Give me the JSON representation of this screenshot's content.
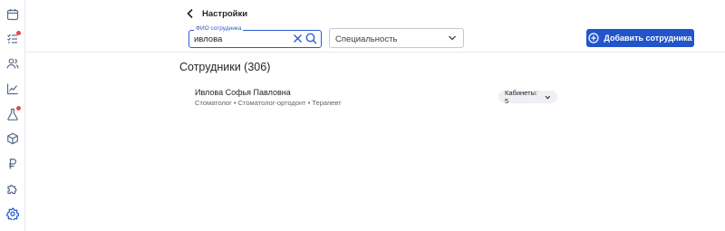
{
  "header": {
    "back_label": "Настройки"
  },
  "filters": {
    "search_label": "ФИО сотрудника",
    "search_value": "ивлова",
    "specialty_placeholder": "Специальность"
  },
  "actions": {
    "add_employee_label": "Добавить сотрудника"
  },
  "main": {
    "title": "Сотрудники (306)",
    "employees": [
      {
        "name": "Ивлова Софья Павловна",
        "specialties": "Стоматолог • Стоматолог-ортодонт • Терапевт",
        "rooms_label": "Кабинеты: 5"
      }
    ]
  },
  "sidebar": {
    "icons": [
      "calendar-icon",
      "checklist-icon",
      "users-icon",
      "chart-icon",
      "flask-icon",
      "box-icon",
      "ruble-icon",
      "puzzle-icon",
      "gear-icon"
    ]
  },
  "colors": {
    "accent": "#2155c9",
    "badge_dot": "#e5484d"
  }
}
